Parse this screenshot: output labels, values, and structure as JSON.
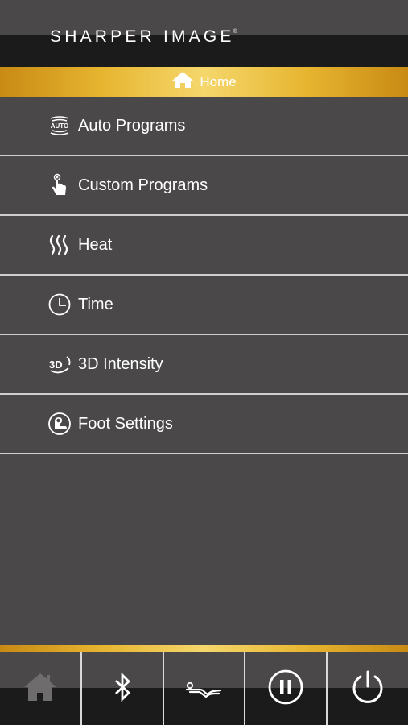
{
  "header": {
    "brand": "SHARPER IMAGE",
    "brand_mark": "®"
  },
  "breadcrumb": {
    "label": "Home",
    "icon": "home-icon"
  },
  "menu": {
    "items": [
      {
        "label": "Auto Programs",
        "icon": "auto-icon"
      },
      {
        "label": "Custom Programs",
        "icon": "hand-touch-icon"
      },
      {
        "label": "Heat",
        "icon": "heat-icon"
      },
      {
        "label": "Time",
        "icon": "clock-icon"
      },
      {
        "label": "3D Intensity",
        "icon": "3d-icon"
      },
      {
        "label": "Foot Settings",
        "icon": "foot-icon"
      }
    ]
  },
  "tabbar": {
    "items": [
      {
        "icon": "home-icon",
        "active": false
      },
      {
        "icon": "bluetooth-icon"
      },
      {
        "icon": "recline-icon"
      },
      {
        "icon": "pause-icon"
      },
      {
        "icon": "power-icon"
      }
    ]
  },
  "colors": {
    "background": "#4a4849",
    "dark_band": "#1c1b1b",
    "gold": "#e7b530",
    "divider": "#cfcfcf"
  }
}
